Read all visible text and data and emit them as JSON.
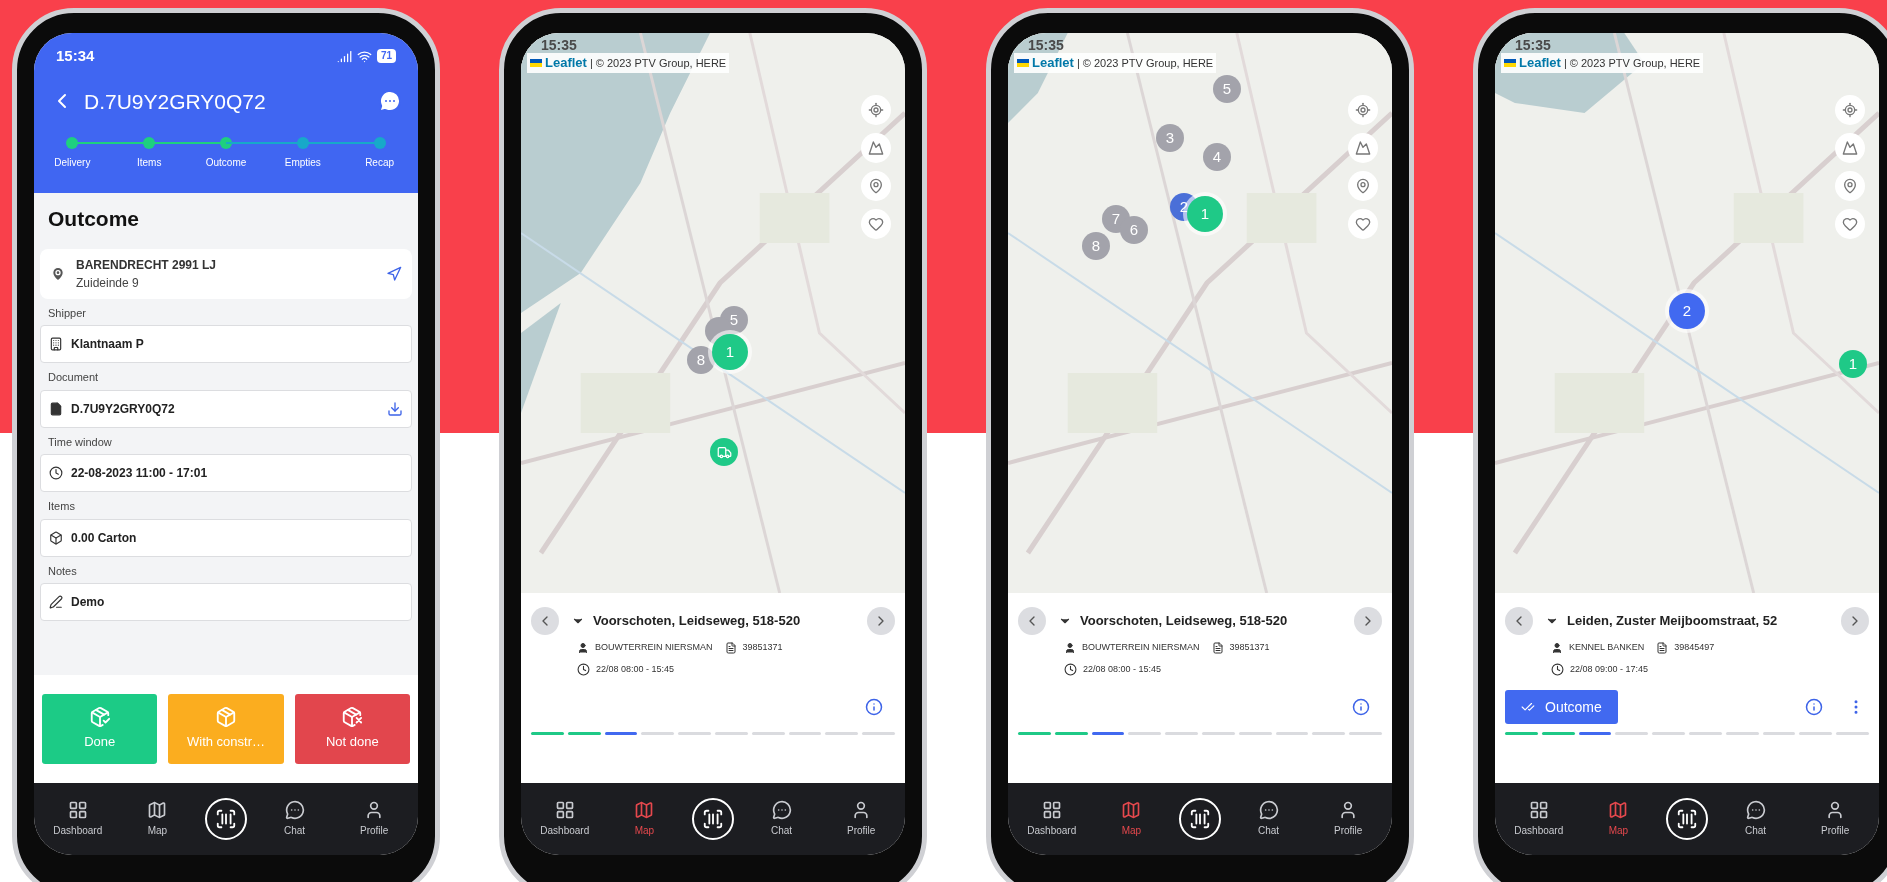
{
  "screens": [
    {
      "kind": "order_detail",
      "status_bar": {
        "time": "15:34",
        "battery": "71"
      },
      "title": "D.7U9Y2GRY0Q72",
      "steps": [
        {
          "label": "Delivery",
          "done": true
        },
        {
          "label": "Items",
          "done": true
        },
        {
          "label": "Outcome",
          "done": true
        },
        {
          "label": "Empties",
          "done": false
        },
        {
          "label": "Recap",
          "done": false
        }
      ],
      "heading": "Outcome",
      "address": {
        "line1": "BARENDRECHT 2991 LJ",
        "line2": "Zuideinde 9"
      },
      "fields": [
        {
          "kind": "shipper",
          "label": "Shipper",
          "value": "Klantnaam P"
        },
        {
          "kind": "document",
          "label": "Document",
          "value": "D.7U9Y2GRY0Q72"
        },
        {
          "kind": "time",
          "label": "Time window",
          "value": "22-08-2023 11:00 - 17:01"
        },
        {
          "kind": "items",
          "label": "Items",
          "value": "0.00 Carton"
        },
        {
          "kind": "notes",
          "label": "Notes",
          "value": "Demo"
        }
      ],
      "actions": [
        {
          "kind": "done",
          "label": "Done"
        },
        {
          "kind": "constraint",
          "label": "With constr…"
        },
        {
          "kind": "not_done",
          "label": "Not done"
        }
      ],
      "nav": [
        {
          "kind": "dashboard",
          "label": "Dashboard",
          "selected": false
        },
        {
          "kind": "map",
          "label": "Map",
          "selected": false
        },
        {
          "kind": "scan",
          "selected": false
        },
        {
          "kind": "chat",
          "label": "Chat",
          "selected": false
        },
        {
          "kind": "profile",
          "label": "Profile",
          "selected": false
        }
      ]
    },
    {
      "kind": "map",
      "time": "15:35",
      "attribution": {
        "brand": "Leaflet",
        "text": "| © 2023 PTV Group, HERE"
      },
      "markers": [
        {
          "kind": "cluster",
          "label": "5",
          "color": "#a3a3ab",
          "selected": false
        },
        {
          "kind": "cluster",
          "color": "#a3a3ab",
          "selected": false
        },
        {
          "kind": "cluster",
          "label": "8",
          "color": "#a3a3ab",
          "selected": false
        },
        {
          "kind": "cluster",
          "label": "1",
          "color": "#1fc987",
          "selected": true
        },
        {
          "kind": "vehicle",
          "color": "#1fc987",
          "selected": false
        }
      ],
      "stop": {
        "title": "Voorschoten, Leidseweg, 518-520",
        "customer": "BOUWTERREIN NIERSMAN",
        "document": "39851371",
        "time": "22/08 08:00 - 15:45"
      },
      "more": false,
      "progress": [
        {
          "done": true,
          "current": false
        },
        {
          "done": true,
          "current": false
        },
        {
          "done": false,
          "current": true
        },
        {
          "done": false,
          "current": false
        },
        {
          "done": false,
          "current": false
        },
        {
          "done": false,
          "current": false
        },
        {
          "done": false,
          "current": false
        },
        {
          "done": false,
          "current": false
        },
        {
          "done": false,
          "current": false
        },
        {
          "done": false,
          "current": false
        }
      ],
      "nav": [
        {
          "kind": "dashboard",
          "label": "Dashboard",
          "selected": false
        },
        {
          "kind": "map",
          "label": "Map",
          "selected": true
        },
        {
          "kind": "scan",
          "selected": false
        },
        {
          "kind": "chat",
          "label": "Chat",
          "selected": false
        },
        {
          "kind": "profile",
          "label": "Profile",
          "selected": false
        }
      ]
    },
    {
      "kind": "map",
      "time": "15:35",
      "attribution": {
        "brand": "Leaflet",
        "text": "| © 2023 PTV Group, HERE"
      },
      "markers": [
        {
          "kind": "cluster",
          "label": "5",
          "color": "#a3a3ab",
          "selected": false
        },
        {
          "kind": "cluster",
          "label": "3",
          "color": "#a3a3ab",
          "selected": false
        },
        {
          "kind": "cluster",
          "label": "4",
          "color": "#a3a3ab",
          "selected": false
        },
        {
          "kind": "cluster",
          "label": "2",
          "color": "#4a6fd8",
          "selected": false
        },
        {
          "kind": "cluster",
          "label": "1",
          "color": "#1fc987",
          "selected": true
        },
        {
          "kind": "cluster",
          "label": "7",
          "color": "#a3a3ab",
          "selected": false
        },
        {
          "kind": "cluster",
          "label": "6",
          "color": "#a3a3ab",
          "selected": false
        },
        {
          "kind": "cluster",
          "label": "8",
          "color": "#a3a3ab",
          "selected": false
        }
      ],
      "stop": {
        "title": "Voorschoten, Leidseweg, 518-520",
        "customer": "BOUWTERREIN NIERSMAN",
        "document": "39851371",
        "time": "22/08 08:00 - 15:45"
      },
      "more": false,
      "progress": [
        {
          "done": true,
          "current": false
        },
        {
          "done": true,
          "current": false
        },
        {
          "done": false,
          "current": true
        },
        {
          "done": false,
          "current": false
        },
        {
          "done": false,
          "current": false
        },
        {
          "done": false,
          "current": false
        },
        {
          "done": false,
          "current": false
        },
        {
          "done": false,
          "current": false
        },
        {
          "done": false,
          "current": false
        },
        {
          "done": false,
          "current": false
        }
      ],
      "nav": [
        {
          "kind": "dashboard",
          "label": "Dashboard",
          "selected": false
        },
        {
          "kind": "map",
          "label": "Map",
          "selected": true
        },
        {
          "kind": "scan",
          "selected": false
        },
        {
          "kind": "chat",
          "label": "Chat",
          "selected": false
        },
        {
          "kind": "profile",
          "label": "Profile",
          "selected": false
        }
      ]
    },
    {
      "kind": "map",
      "time": "15:35",
      "attribution": {
        "brand": "Leaflet",
        "text": "| © 2023 PTV Group, HERE"
      },
      "markers": [
        {
          "kind": "cluster",
          "label": "2",
          "color": "#4169f0",
          "selected": true
        },
        {
          "kind": "cluster",
          "label": "1",
          "color": "#1fc987",
          "selected": false
        }
      ],
      "stop": {
        "title": "Leiden, Zuster Meijboomstraat, 52",
        "customer": "KENNEL BANKEN",
        "document": "39845497",
        "time": "22/08 09:00 - 17:45"
      },
      "action": {
        "label": "Outcome"
      },
      "more": true,
      "progress": [
        {
          "done": true,
          "current": false
        },
        {
          "done": true,
          "current": false
        },
        {
          "done": false,
          "current": true
        },
        {
          "done": false,
          "current": false
        },
        {
          "done": false,
          "current": false
        },
        {
          "done": false,
          "current": false
        },
        {
          "done": false,
          "current": false
        },
        {
          "done": false,
          "current": false
        },
        {
          "done": false,
          "current": false
        },
        {
          "done": false,
          "current": false
        }
      ],
      "nav": [
        {
          "kind": "dashboard",
          "label": "Dashboard",
          "selected": false
        },
        {
          "kind": "map",
          "label": "Map",
          "selected": true
        },
        {
          "kind": "scan",
          "selected": false
        },
        {
          "kind": "chat",
          "label": "Chat",
          "selected": false
        },
        {
          "kind": "profile",
          "label": "Profile",
          "selected": false
        }
      ]
    }
  ]
}
